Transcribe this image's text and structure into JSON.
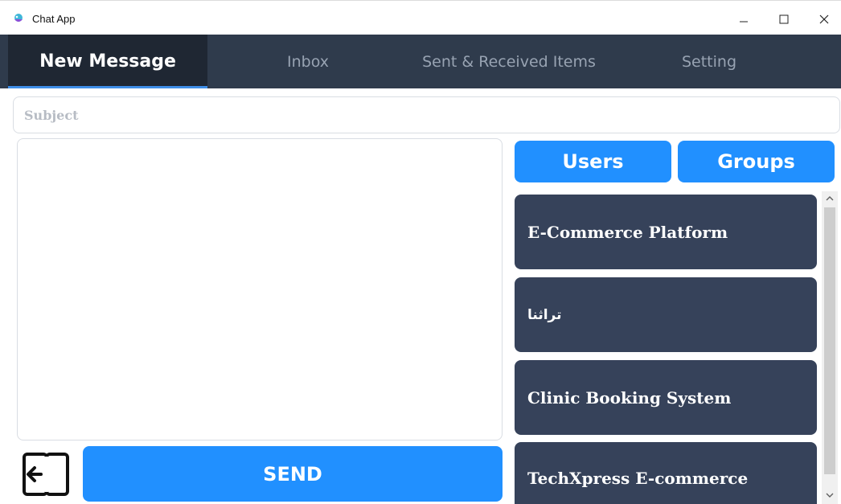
{
  "window": {
    "title": "Chat App"
  },
  "tabs": [
    {
      "label": "New Message",
      "active": true
    },
    {
      "label": "Inbox"
    },
    {
      "label": "Sent & Received Items"
    },
    {
      "label": "Setting"
    }
  ],
  "compose": {
    "subject_placeholder": "Subject",
    "send_label": "SEND"
  },
  "recipients": {
    "users_label": "Users",
    "groups_label": "Groups",
    "items": [
      {
        "label": "E-Commerce Platform"
      },
      {
        "label": "تراثنا"
      },
      {
        "label": "Clinic Booking System"
      },
      {
        "label": "TechXpress E-commerce"
      }
    ]
  },
  "colors": {
    "navbar": "#2f3b4c",
    "active_tab": "#1f2733",
    "accent": "#2190ff",
    "list_item": "#36425a"
  }
}
